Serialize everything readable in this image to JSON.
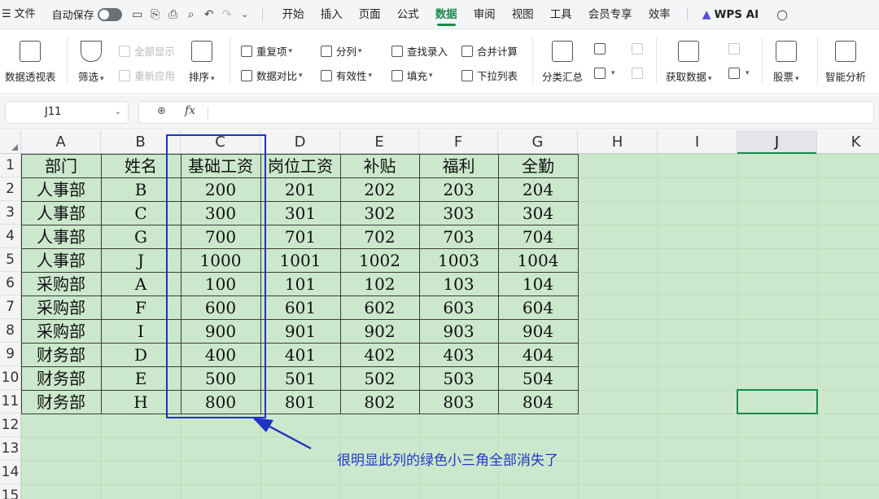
{
  "menu": {
    "file_label": "文件",
    "autosave_label": "自动保存",
    "tabs": [
      "开始",
      "插入",
      "页面",
      "公式",
      "数据",
      "审阅",
      "视图",
      "工具",
      "会员专享",
      "效率"
    ],
    "active_tab": "数据",
    "ai_label": "WPS AI"
  },
  "ribbon": {
    "pivot": "数据透视表",
    "filter": "筛选",
    "show_all": "全部显示",
    "reapply": "重新应用",
    "sort": "排序",
    "duplicates": "重复项",
    "compare": "数据对比",
    "split": "分列",
    "validity": "有效性",
    "lookup_entry": "查找录入",
    "fill": "填充",
    "consolidate": "合并计算",
    "dropdown_list": "下拉列表",
    "subtotal": "分类汇总",
    "get_data": "获取数据",
    "stocks": "股票",
    "smart_analysis": "智能分析"
  },
  "formula_bar": {
    "name_box": "J11",
    "fx_label": "fx",
    "formula": ""
  },
  "sheet": {
    "columns": [
      "A",
      "B",
      "C",
      "D",
      "E",
      "F",
      "G",
      "H",
      "I",
      "J",
      "K"
    ],
    "selected_column": "J",
    "rows": [
      "1",
      "2",
      "3",
      "4",
      "5",
      "6",
      "7",
      "8",
      "9",
      "10",
      "11",
      "12",
      "13",
      "14",
      "15"
    ],
    "table": [
      [
        "部门",
        "姓名",
        "基础工资",
        "岗位工资",
        "补贴",
        "福利",
        "全勤"
      ],
      [
        "人事部",
        "B",
        "200",
        "201",
        "202",
        "203",
        "204"
      ],
      [
        "人事部",
        "C",
        "300",
        "301",
        "302",
        "303",
        "304"
      ],
      [
        "人事部",
        "G",
        "700",
        "701",
        "702",
        "703",
        "704"
      ],
      [
        "人事部",
        "J",
        "1000",
        "1001",
        "1002",
        "1003",
        "1004"
      ],
      [
        "采购部",
        "A",
        "100",
        "101",
        "102",
        "103",
        "104"
      ],
      [
        "采购部",
        "F",
        "600",
        "601",
        "602",
        "603",
        "604"
      ],
      [
        "采购部",
        "I",
        "900",
        "901",
        "902",
        "903",
        "904"
      ],
      [
        "财务部",
        "D",
        "400",
        "401",
        "402",
        "403",
        "404"
      ],
      [
        "财务部",
        "E",
        "500",
        "501",
        "502",
        "503",
        "504"
      ],
      [
        "财务部",
        "H",
        "800",
        "801",
        "802",
        "803",
        "804"
      ]
    ],
    "selected_cell": "J11"
  },
  "annotation": {
    "text": "很明显此列的绿色小三角全部消失了",
    "color": "#1f33c4"
  },
  "colors": {
    "accent": "#1a8a4b",
    "sheet_bg": "#cbe8cc"
  }
}
